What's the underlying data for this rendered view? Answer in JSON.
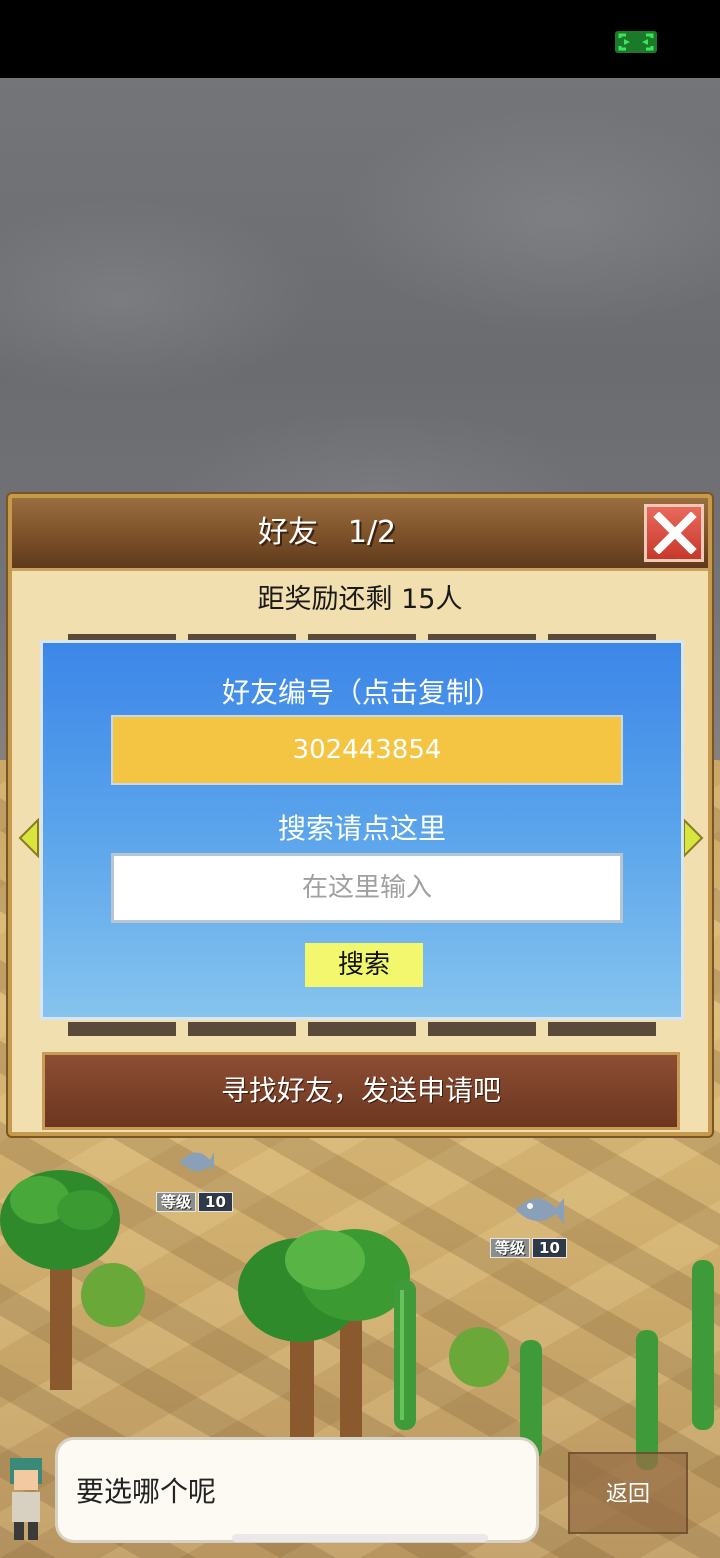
{
  "status_bar": {
    "fullscreen_icon": "fullscreen-toggle-icon"
  },
  "dialog": {
    "title": "好友　1/2",
    "close_icon": "close-x-icon",
    "reward_text": "距奖励还剩 15人",
    "panel": {
      "friend_id_label": "好友编号（点击复制）",
      "friend_id": "302443854",
      "search_label": "搜索请点这里",
      "search_placeholder": "在这里输入",
      "search_button": "搜索"
    },
    "bottom_banner": "寻找好友，发送申请吧"
  },
  "scene": {
    "level_tags": [
      {
        "label": "等级",
        "value": "10"
      },
      {
        "label": "等级",
        "value": "10"
      }
    ]
  },
  "dialogue": {
    "speech": "要选哪个呢",
    "back_button": "返回"
  },
  "colors": {
    "friend_id_bg": "#f4c443",
    "search_button_bg": "#f3f76d",
    "panel_blue": "#3c86e8",
    "close_red": "#d04a3e"
  }
}
